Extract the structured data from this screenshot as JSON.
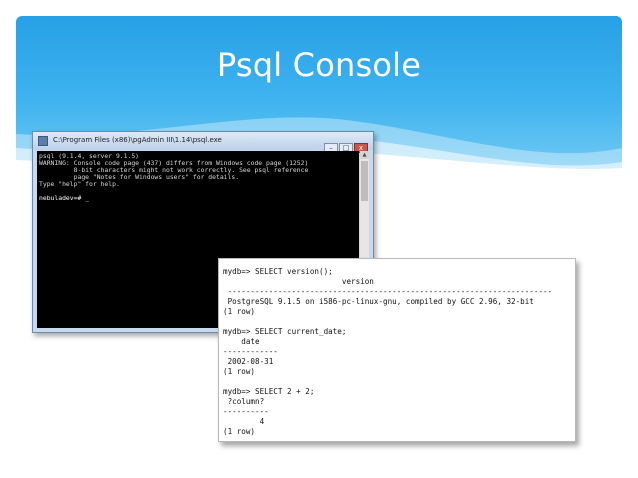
{
  "slide": {
    "title": "Psql Console",
    "colors": {
      "banner_top": "#27a0e6",
      "banner_bottom": "#73caf3",
      "console_bg": "#000000"
    }
  },
  "console_window": {
    "title": "C:\\Program Files (x86)\\pgAdmin III\\1.14\\psql.exe",
    "buttons": {
      "minimize": "–",
      "maximize": "□",
      "close": "x"
    },
    "lines": [
      "psql (9.1.4, server 9.1.5)",
      "WARNING: Console code page (437) differs from Windows code page (1252)",
      "         8-bit characters might not work correctly. See psql reference",
      "         page \"Notes for Windows users\" for details.",
      "Type \"help\" for help.",
      "",
      "nebuladev=# _"
    ]
  },
  "query_output": {
    "lines": [
      "mydb=> SELECT version();",
      "                          version",
      " -----------------------------------------------------------------------",
      " PostgreSQL 9.1.5 on i586-pc-linux-gnu, compiled by GCC 2.96, 32-bit",
      "(1 row)",
      "",
      "mydb=> SELECT current_date;",
      "    date",
      "------------",
      " 2002-08-31",
      "(1 row)",
      "",
      "mydb=> SELECT 2 + 2;",
      " ?column?",
      "----------",
      "        4",
      "(1 row)"
    ]
  }
}
